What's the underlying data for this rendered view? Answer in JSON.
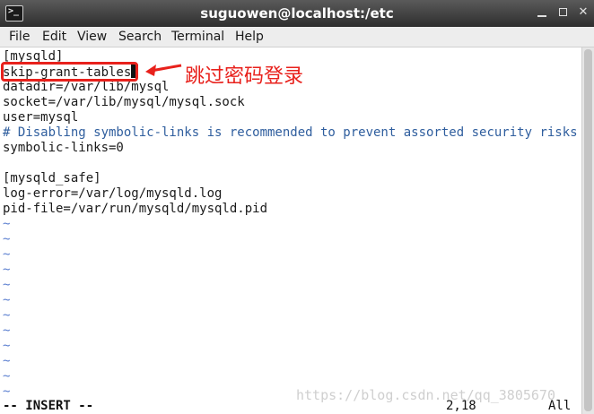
{
  "window": {
    "title": "suguowen@localhost:/etc"
  },
  "menu": [
    "File",
    "Edit",
    "View",
    "Search",
    "Terminal",
    "Help"
  ],
  "lines": [
    {
      "text": "[mysqld]",
      "kind": "normal"
    },
    {
      "text": "skip-grant-tables",
      "kind": "normal"
    },
    {
      "text": "datadir=/var/lib/mysql",
      "kind": "normal"
    },
    {
      "text": "socket=/var/lib/mysql/mysql.sock",
      "kind": "normal"
    },
    {
      "text": "user=mysql",
      "kind": "normal"
    },
    {
      "text": "# Disabling symbolic-links is recommended to prevent assorted security risks",
      "kind": "comment"
    },
    {
      "text": "symbolic-links=0",
      "kind": "normal"
    },
    {
      "text": "",
      "kind": "normal"
    },
    {
      "text": "[mysqld_safe]",
      "kind": "normal"
    },
    {
      "text": "log-error=/var/log/mysqld.log",
      "kind": "normal"
    },
    {
      "text": "pid-file=/var/run/mysqld/mysqld.pid",
      "kind": "normal"
    }
  ],
  "tilde": [
    "~",
    "~",
    "~",
    "~",
    "~",
    "~",
    "~",
    "~",
    "~",
    "~",
    "~",
    "~"
  ],
  "annotation": {
    "text": "跳过密码登录",
    "color": "#e8211c"
  },
  "status": {
    "mode": "-- INSERT --",
    "position": "2,18",
    "scroll": "All"
  },
  "watermark": "https://blog.csdn.net/qq_3805670",
  "colors": {
    "comment": "#2f5e9e",
    "tilde": "#5b7fd0"
  }
}
